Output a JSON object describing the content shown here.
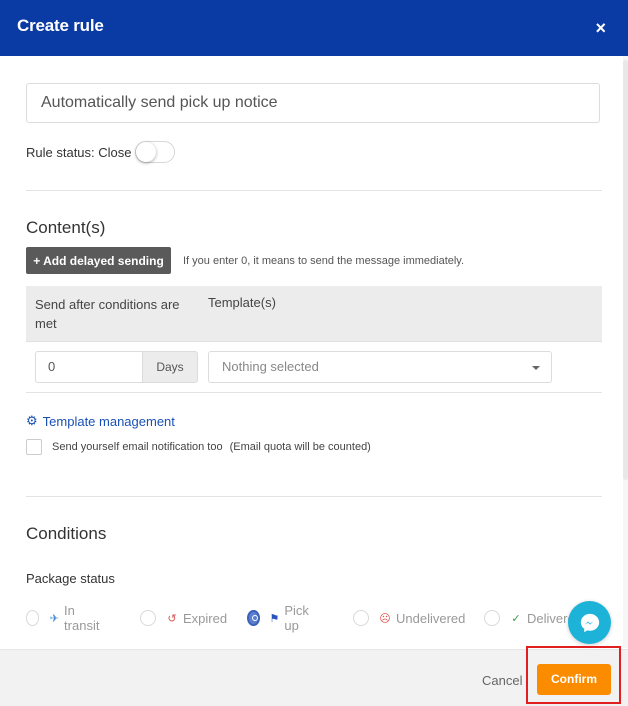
{
  "dialog": {
    "title": "Create rule",
    "close_glyph": "×"
  },
  "rule": {
    "name": "Automatically send pick up notice",
    "status_label": "Rule status: Close"
  },
  "content": {
    "section_title": "Content(s)",
    "add_button": "+ Add delayed sending",
    "hint": "If you enter 0, it means to send the message immediately.",
    "columns": [
      "Send after conditions are met",
      "Template(s)"
    ],
    "days_value": "0",
    "days_unit": "Days",
    "template_selected": "Nothing selected",
    "template_management": "Template management",
    "self_notify_label": "Send yourself email notification too",
    "quota_note": "(Email quota will be counted)"
  },
  "conditions": {
    "section_title": "Conditions",
    "package_status_label": "Package status",
    "statuses": [
      {
        "label": "In transit",
        "icon": "airplane-icon",
        "glyph": "✈",
        "color": "#4a90d9",
        "selected": false
      },
      {
        "label": "Expired",
        "icon": "history-icon",
        "glyph": "↺",
        "color": "#d9534f",
        "selected": false
      },
      {
        "label": "Pick up",
        "icon": "flag-icon",
        "glyph": "⚑",
        "color": "#2a52be",
        "selected": true
      },
      {
        "label": "Undelivered",
        "icon": "sad-face-icon",
        "glyph": "☹",
        "color": "#e0534a",
        "selected": false
      },
      {
        "label": "Delivered",
        "icon": "check-icon",
        "glyph": "✓",
        "color": "#3a9a4a",
        "selected": false
      }
    ]
  },
  "footer": {
    "cancel_label": "Cancel",
    "confirm_label": "Confirm"
  },
  "colors": {
    "header": "#0a3aa3",
    "confirm": "#fb8c00",
    "chat": "#1db3d8",
    "highlight": "#e02020",
    "link": "#1a50b4"
  }
}
